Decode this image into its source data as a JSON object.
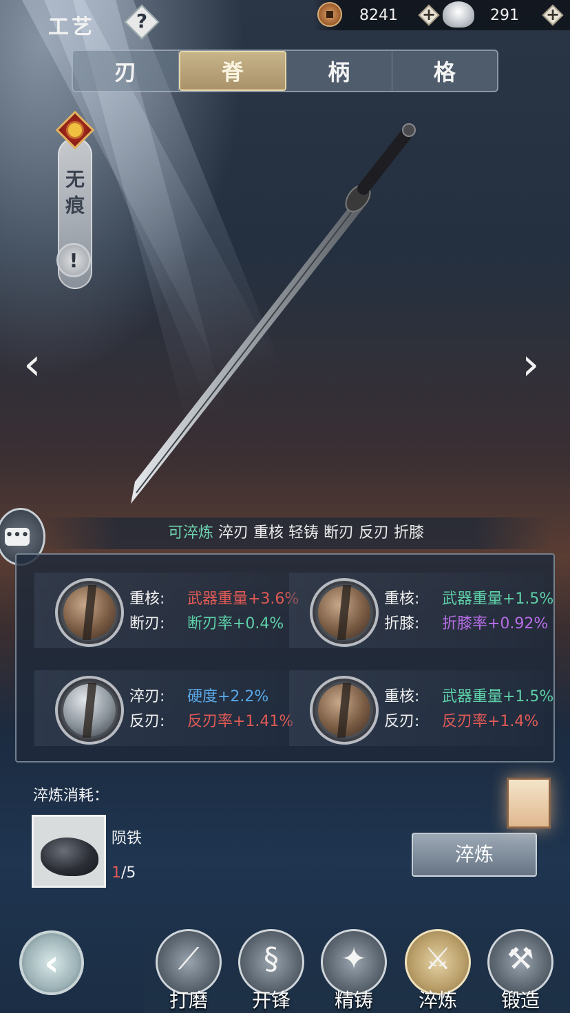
{
  "header": {
    "title": "工艺",
    "help_symbol": "?",
    "coins": "8241",
    "silver": "291",
    "plus_symbol": "+"
  },
  "part_tabs": [
    {
      "label": "刃",
      "active": false
    },
    {
      "label": "脊",
      "active": true
    },
    {
      "label": "柄",
      "active": false
    },
    {
      "label": "格",
      "active": false
    }
  ],
  "weapon": {
    "name": "无痕",
    "info_symbol": "!"
  },
  "navigation": {
    "prev": "‹",
    "next": "›"
  },
  "refine_strip": {
    "prefix": "可淬炼",
    "options": "淬刃 重核 轻铸 断刃 反刃 折膝"
  },
  "results": [
    {
      "row1_label": "重核:",
      "row1_value": "武器重量+3.6%",
      "row1_color": "#e25a55",
      "row2_label": "断刃:",
      "row2_value": "断刃率+0.4%",
      "row2_color": "#5ed0a8"
    },
    {
      "row1_label": "重核:",
      "row1_value": "武器重量+1.5%",
      "row1_color": "#5ed0a8",
      "row2_label": "折膝:",
      "row2_value": "折膝率+0.92%",
      "row2_color": "#b86ee8"
    },
    {
      "row1_label": "淬刃:",
      "row1_value": "硬度+2.2%",
      "row1_color": "#5aa8e8",
      "row2_label": "反刃:",
      "row2_value": "反刃率+1.41%",
      "row2_color": "#e25a55"
    },
    {
      "row1_label": "重核:",
      "row1_value": "武器重量+1.5%",
      "row1_color": "#5ed0a8",
      "row2_label": "反刃:",
      "row2_value": "反刃率+1.4%",
      "row2_color": "#e25a55"
    }
  ],
  "cost": {
    "label": "淬炼消耗：",
    "material_name": "陨铁",
    "owned": "1",
    "required": "/5"
  },
  "refine_button": "淬炼",
  "bottom_nav": [
    {
      "label": "打磨",
      "icon": "whetstone-icon",
      "active": false
    },
    {
      "label": "开锋",
      "icon": "sword-coil-icon",
      "active": false
    },
    {
      "label": "精铸",
      "icon": "shuriken-icon",
      "active": false
    },
    {
      "label": "淬炼",
      "icon": "crossed-sword-icon",
      "active": true
    },
    {
      "label": "锻造",
      "icon": "anvil-icon",
      "active": false
    }
  ],
  "back_symbol": "‹"
}
